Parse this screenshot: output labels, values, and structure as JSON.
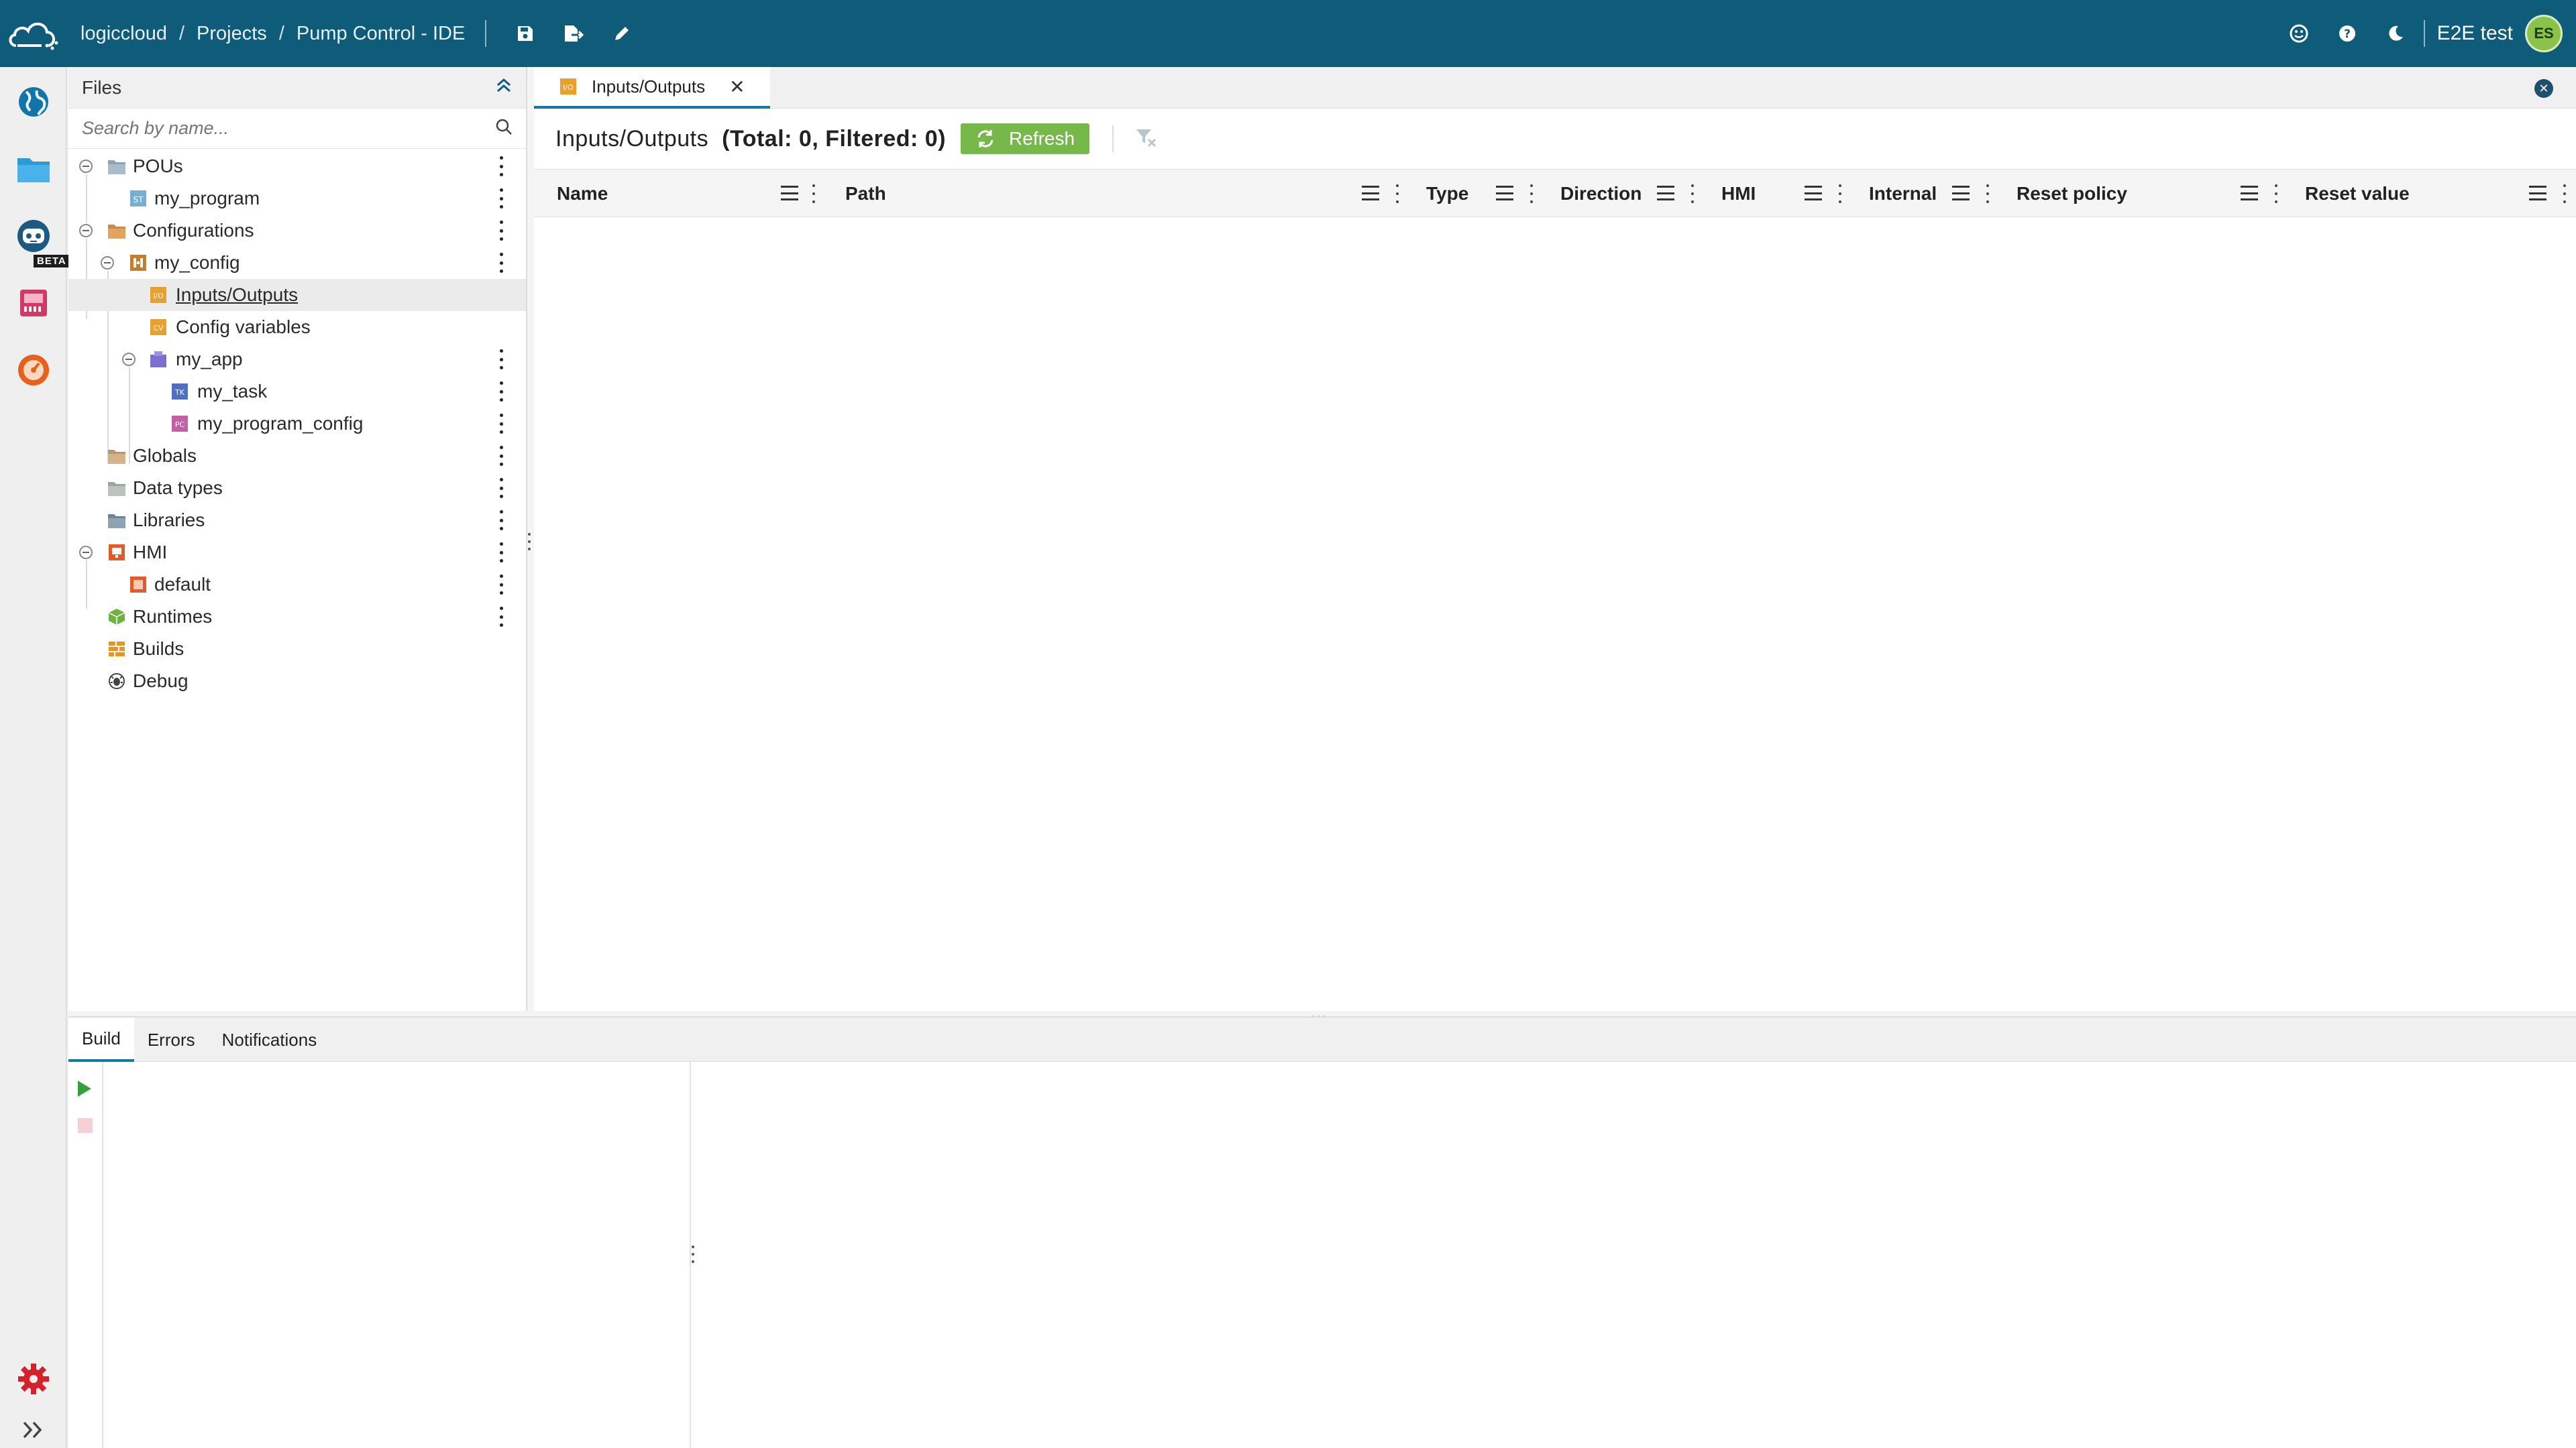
{
  "topbar": {
    "breadcrumbs": [
      "logiccloud",
      "Projects",
      "Pump Control - IDE"
    ],
    "user_name": "E2E test",
    "user_initials": "ES"
  },
  "rail": {
    "beta_label": "BETA"
  },
  "files": {
    "title": "Files",
    "search_placeholder": "Search by name...",
    "tree": [
      {
        "label": "POUs"
      },
      {
        "label": "my_program"
      },
      {
        "label": "Configurations"
      },
      {
        "label": "my_config"
      },
      {
        "label": "Inputs/Outputs"
      },
      {
        "label": "Config variables"
      },
      {
        "label": "my_app"
      },
      {
        "label": "my_task"
      },
      {
        "label": "my_program_config"
      },
      {
        "label": "Globals"
      },
      {
        "label": "Data types"
      },
      {
        "label": "Libraries"
      },
      {
        "label": "HMI"
      },
      {
        "label": "default"
      },
      {
        "label": "Runtimes"
      },
      {
        "label": "Builds"
      },
      {
        "label": "Debug"
      }
    ]
  },
  "editor": {
    "tab_label": "Inputs/Outputs",
    "title": "Inputs/Outputs",
    "counts": "(Total: 0, Filtered: 0)",
    "refresh_label": "Refresh",
    "columns": [
      "Name",
      "Path",
      "Type",
      "Direction",
      "HMI",
      "Internal",
      "Reset policy",
      "Reset value"
    ]
  },
  "bottom": {
    "tabs": [
      "Build",
      "Errors",
      "Notifications"
    ]
  },
  "colors": {
    "topbar": "#0f5b7a",
    "accent": "#0f7aa8",
    "refresh": "#77b84a"
  }
}
